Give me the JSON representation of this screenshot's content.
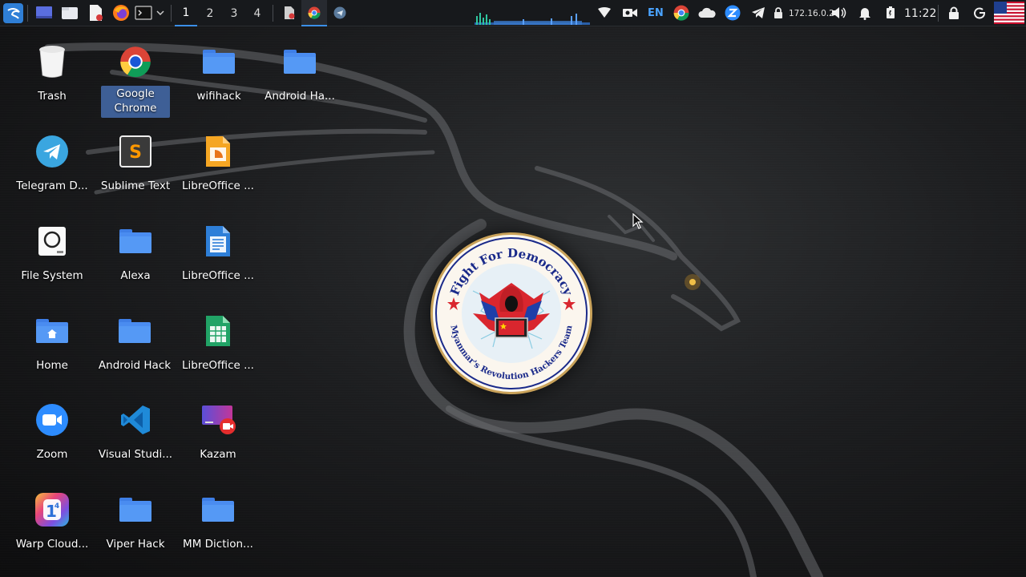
{
  "panel": {
    "workspaces": [
      "1",
      "2",
      "3",
      "4"
    ],
    "active_workspace": "1",
    "keyboard_layout": "EN",
    "ip_address": "172.16.0.2",
    "clock": "11:22",
    "icons": {
      "menu": "kali-menu-icon",
      "desktop": "show-desktop-icon",
      "files": "file-manager-icon",
      "editor": "text-editor-icon",
      "browser": "firefox-icon",
      "terminal": "terminal-icon",
      "chrome_task": "chrome-task-icon",
      "telegram_task": "telegram-task-icon"
    }
  },
  "desktop": {
    "icons": [
      {
        "label": "Trash",
        "icon": "trash-icon"
      },
      {
        "label": "Google Chrome",
        "icon": "chrome-icon"
      },
      {
        "label": "wifihack",
        "icon": "folder-icon"
      },
      {
        "label": "Android Ha...",
        "icon": "folder-icon"
      },
      {
        "label": "Telegram D...",
        "icon": "telegram-icon"
      },
      {
        "label": "Sublime Text",
        "icon": "sublime-icon"
      },
      {
        "label": "LibreOffice ...",
        "icon": "impress-icon"
      },
      {
        "label": "File System",
        "icon": "drive-icon"
      },
      {
        "label": "Alexa",
        "icon": "folder-icon"
      },
      {
        "label": "LibreOffice ...",
        "icon": "writer-icon"
      },
      {
        "label": "Home",
        "icon": "home-folder-icon"
      },
      {
        "label": "Android Hack",
        "icon": "folder-icon"
      },
      {
        "label": "LibreOffice ...",
        "icon": "calc-icon"
      },
      {
        "label": "Zoom",
        "icon": "zoom-icon"
      },
      {
        "label": "Visual Studi...",
        "icon": "vscode-icon"
      },
      {
        "label": "Kazam",
        "icon": "kazam-icon"
      },
      {
        "label": "Warp Cloud...",
        "icon": "warp-icon"
      },
      {
        "label": "Viper Hack",
        "icon": "folder-icon"
      },
      {
        "label": "MM Diction...",
        "icon": "folder-icon"
      }
    ]
  },
  "emblem": {
    "top_text": "Fight For Democracy",
    "bottom_text": "Myanmar's Revolution Hackers Team"
  },
  "colors": {
    "panel_bg": "#17191c",
    "accent": "#3b8fe8",
    "folder": "#4a8cf0",
    "selection": "#3e5f96"
  }
}
